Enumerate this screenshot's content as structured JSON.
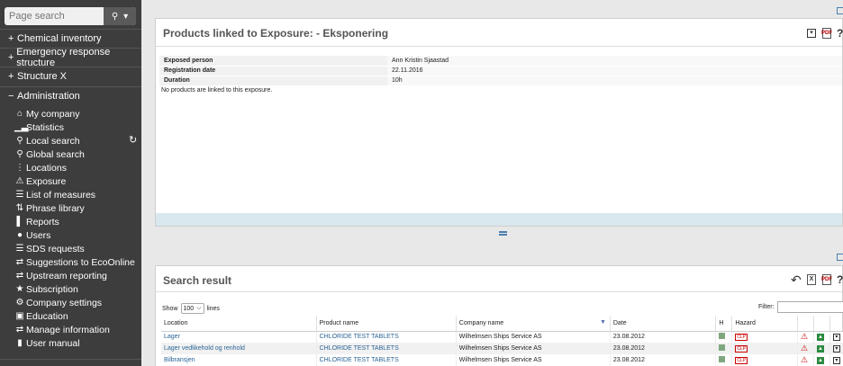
{
  "sidebar": {
    "search_placeholder": "Page search",
    "sections": [
      {
        "sign": "+",
        "label": "Chemical inventory"
      },
      {
        "sign": "+",
        "label": "Emergency response structure"
      },
      {
        "sign": "+",
        "label": "Structure X"
      },
      {
        "sign": "−",
        "label": "Administration"
      }
    ],
    "items": [
      {
        "icon": "home-icon",
        "glyph": "⌂",
        "label": "My company"
      },
      {
        "icon": "bar-chart-icon",
        "glyph": "▁▃",
        "label": "Statistics"
      },
      {
        "icon": "search-icon",
        "glyph": "⚲",
        "label": "Local search"
      },
      {
        "icon": "search-icon",
        "glyph": "⚲",
        "label": "Global search"
      },
      {
        "icon": "sitemap-icon",
        "glyph": "⋮",
        "label": "Locations"
      },
      {
        "icon": "warning-icon",
        "glyph": "⚠",
        "label": "Exposure"
      },
      {
        "icon": "list-icon",
        "glyph": "☰",
        "label": "List of measures"
      },
      {
        "icon": "sort-icon",
        "glyph": "⇅",
        "label": "Phrase library"
      },
      {
        "icon": "chart-icon",
        "glyph": "▌",
        "label": "Reports"
      },
      {
        "icon": "user-icon",
        "glyph": "●",
        "label": "Users"
      },
      {
        "icon": "list-icon",
        "glyph": "☰",
        "label": "SDS requests"
      },
      {
        "icon": "exchange-icon",
        "glyph": "⇄",
        "label": "Suggestions to EcoOnline"
      },
      {
        "icon": "exchange-icon",
        "glyph": "⇄",
        "label": "Upstream reporting"
      },
      {
        "icon": "star-icon",
        "glyph": "★",
        "label": "Subscription"
      },
      {
        "icon": "gear-icon",
        "glyph": "⚙",
        "label": "Company settings"
      },
      {
        "icon": "film-icon",
        "glyph": "▣",
        "label": "Education"
      },
      {
        "icon": "exchange-icon",
        "glyph": "⇄",
        "label": "Manage information"
      },
      {
        "icon": "book-icon",
        "glyph": "▮",
        "label": "User manual"
      }
    ]
  },
  "products_panel": {
    "title": "Products linked to Exposure: - Eksponering",
    "info": [
      {
        "label": "Exposed person",
        "value": "Ann Kristin Sjaastad"
      },
      {
        "label": "Registration date",
        "value": "22.11.2016"
      },
      {
        "label": "Duration",
        "value": "10h"
      }
    ],
    "empty_message": "No products are linked to this exposure."
  },
  "search_panel": {
    "title": "Search result",
    "show_label": "Show",
    "show_value": "100",
    "lines_label": "lines",
    "filter_label": "Filter:",
    "columns": [
      "Location",
      "Product name",
      "Company name",
      "Date",
      "H",
      "Hazard"
    ],
    "rows": [
      {
        "location": "Lager",
        "product": "CHLORIDE TEST TABLETS",
        "company": "Wilhelmsen Ships Service AS",
        "date": "23.08.2012",
        "hazard": "CLP"
      },
      {
        "location": "Lager vedlikehold og renhold",
        "product": "CHLORIDE TEST TABLETS",
        "company": "Wilhelmsen Ships Service AS",
        "date": "23.08.2012",
        "hazard": "CLP"
      },
      {
        "location": "Bilbransjen",
        "product": "CHLORIDE TEST TABLETS",
        "company": "Wilhelmsen Ships Service AS",
        "date": "23.08.2012",
        "hazard": "CLP"
      }
    ]
  },
  "colors": {
    "sidebar_bg": "#3d3d3d",
    "link": "#2a6496",
    "hazard_red": "#cc0000"
  }
}
